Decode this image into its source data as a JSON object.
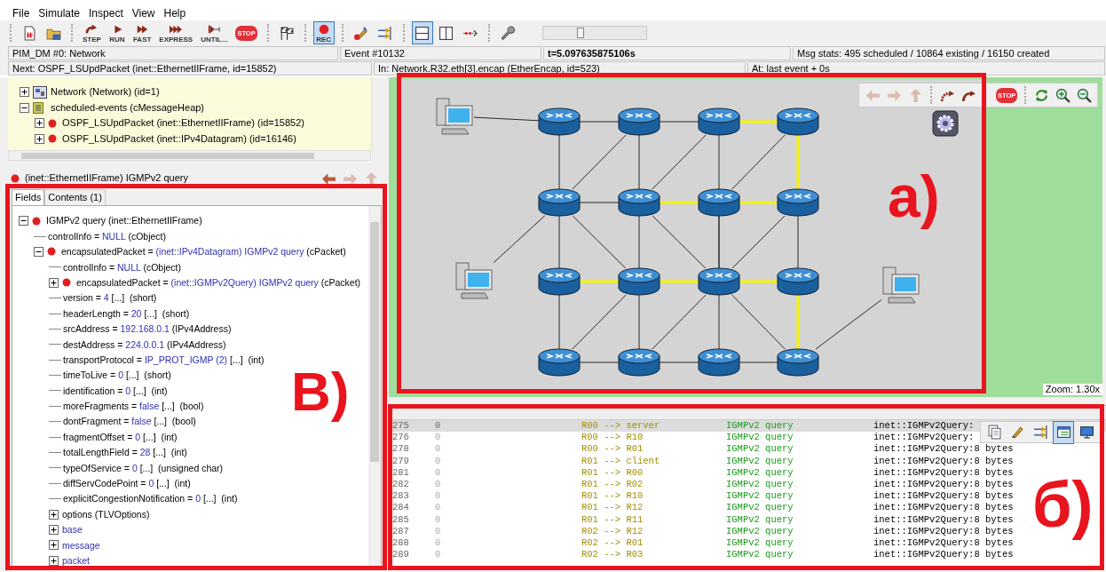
{
  "menu": [
    {
      "label": "File"
    },
    {
      "label": "Simulate"
    },
    {
      "label": "Inspect"
    },
    {
      "label": "View"
    },
    {
      "label": "Help"
    }
  ],
  "toolbar": [
    {
      "kind": "separator"
    },
    {
      "kind": "new"
    },
    {
      "kind": "open"
    },
    {
      "kind": "separator"
    },
    {
      "kind": "step",
      "label": "STEP"
    },
    {
      "kind": "run",
      "label": "RUN"
    },
    {
      "kind": "fast",
      "label": "FAST"
    },
    {
      "kind": "express",
      "label": "EXPRESS"
    },
    {
      "kind": "until",
      "label": "UNTIL..."
    },
    {
      "kind": "stop",
      "label": "STOP"
    },
    {
      "kind": "separator"
    },
    {
      "kind": "finish"
    },
    {
      "kind": "separator"
    },
    {
      "kind": "rec",
      "label": "REC",
      "pressed": true
    },
    {
      "kind": "separator"
    },
    {
      "kind": "inspect"
    },
    {
      "kind": "arrow"
    },
    {
      "kind": "separator"
    },
    {
      "kind": "layout-h",
      "pressed": true
    },
    {
      "kind": "layout-v",
      "pressed": false
    },
    {
      "kind": "timeline"
    },
    {
      "kind": "separator"
    },
    {
      "kind": "wrench"
    }
  ],
  "speed_slider": {
    "level": 0.37
  },
  "status_bar": [
    {
      "text": "PIM_DM #0: Network",
      "bold": false
    },
    {
      "text": "Event #10132",
      "bold": false
    },
    {
      "text": "t=5.097635875106s",
      "bold": true
    },
    {
      "text": "Msg stats: 495 scheduled / 10864 existing / 16150 created",
      "bold": false
    }
  ],
  "next_bar": [
    {
      "text": "Next: OSPF_LSUpdPacket (inet::EthernetIIFrame, id=15852)"
    },
    {
      "text": "In: Network.R32.eth[3].encap (EtherEncap, id=523)"
    },
    {
      "text": "At: last event + 0s"
    }
  ],
  "object_tree": [
    {
      "kind": "network",
      "label": "Network (Network) (id=1)",
      "expanded": false
    },
    {
      "kind": "queue",
      "label": "scheduled-events (cMessageHeap)",
      "expanded": true,
      "children": [
        {
          "kind": "message",
          "label": "OSPF_LSUpdPacket (inet::EthernetIIFrame) (id=15852)",
          "expanded": false
        },
        {
          "kind": "message",
          "label": "OSPF_LSUpdPacket (inet::IPv4Datagram) (id=16146)",
          "expanded": false
        }
      ]
    }
  ],
  "inspector": {
    "title": "(inet::EthernetIIFrame) IGMPv2 query",
    "nav": [
      {
        "kind": "back",
        "disabled": false
      },
      {
        "kind": "forward",
        "disabled": true
      },
      {
        "kind": "up",
        "disabled": true
      }
    ],
    "tabs": [
      {
        "label": "Fields",
        "selected": true
      },
      {
        "label": "Contents (1)",
        "selected": false
      }
    ],
    "fields": [
      {
        "kind": "message",
        "label": "IGMPv2 query (inet::EthernetIIFrame)",
        "expanded": true,
        "children": [
          {
            "kind": "field",
            "label": "controlInfo = ",
            "value": "NULL",
            "rest": " (cObject)"
          },
          {
            "kind": "message",
            "label": "encapsulatedPacket = ",
            "value": "(inet::IPv4Datagram) IGMPv2 query",
            "rest": " (cPacket)",
            "expanded": true,
            "children": [
              {
                "kind": "field",
                "label": "controlInfo = ",
                "value": "NULL",
                "rest": " (cObject)"
              },
              {
                "kind": "message",
                "label": "encapsulatedPacket = ",
                "value": "(inet::IGMPv2Query) IGMPv2 query",
                "rest": " (cPacket)",
                "expanded": false
              },
              {
                "kind": "field",
                "label": "version = ",
                "value": "4",
                "rest": " [...]  (short)"
              },
              {
                "kind": "field",
                "label": "headerLength = ",
                "value": "20",
                "rest": " [...]  (short)"
              },
              {
                "kind": "field",
                "label": "srcAddress = ",
                "value": "192.168.0.1",
                "rest": " (IPv4Address)"
              },
              {
                "kind": "field",
                "label": "destAddress = ",
                "value": "224.0.0.1",
                "rest": " (IPv4Address)"
              },
              {
                "kind": "field",
                "label": "transportProtocol = ",
                "value": "IP_PROT_IGMP (2)",
                "rest": " [...]  (int)"
              },
              {
                "kind": "field",
                "label": "timeToLive = ",
                "value": "0",
                "rest": " [...]  (short)"
              },
              {
                "kind": "field",
                "label": "identification = ",
                "value": "0",
                "rest": " [...]  (int)"
              },
              {
                "kind": "field",
                "label": "moreFragments = ",
                "value": "false",
                "rest": " [...]  (bool)"
              },
              {
                "kind": "field",
                "label": "dontFragment = ",
                "value": "false",
                "rest": " [...]  (bool)"
              },
              {
                "kind": "field",
                "label": "fragmentOffset = ",
                "value": "0",
                "rest": " [...]  (int)"
              },
              {
                "kind": "field",
                "label": "totalLengthField = ",
                "value": "28",
                "rest": " [...]  (int)"
              },
              {
                "kind": "field",
                "label": "typeOfService = ",
                "value": "0",
                "rest": " [...]  (unsigned char)"
              },
              {
                "kind": "field",
                "label": "diffServCodePoint = ",
                "value": "0",
                "rest": " [...]  (int)"
              },
              {
                "kind": "field",
                "label": "explicitCongestionNotification = ",
                "value": "0",
                "rest": " [...]  (int)"
              },
              {
                "kind": "field",
                "label": "options (TLVOptions)",
                "expanded": false
              },
              {
                "kind": "field",
                "value": "base",
                "expanded": false
              },
              {
                "kind": "field",
                "value": "message",
                "expanded": false
              },
              {
                "kind": "field",
                "value": "packet",
                "expanded": false
              }
            ]
          }
        ]
      }
    ],
    "annotation": "B)"
  },
  "network": {
    "toolbar": [
      {
        "kind": "back",
        "disabled": true
      },
      {
        "kind": "forward",
        "disabled": true
      },
      {
        "kind": "up",
        "disabled": true
      },
      {
        "kind": "separator"
      },
      {
        "kind": "curve-left"
      },
      {
        "kind": "curve-right"
      },
      {
        "kind": "stop",
        "label": "STOP"
      },
      {
        "kind": "separator"
      },
      {
        "kind": "refresh"
      },
      {
        "kind": "zoom-in"
      },
      {
        "kind": "zoom-out"
      }
    ],
    "zoom": "Zoom: 1.30x",
    "annotation": "a)"
  },
  "log": {
    "toolbar": [
      {
        "kind": "copy"
      },
      {
        "kind": "find"
      },
      {
        "kind": "filter"
      },
      {
        "kind": "layout",
        "pressed": true
      },
      {
        "kind": "screen"
      }
    ],
    "rows": [
      {
        "event": "275",
        "time": "0",
        "route": "R00 --> server",
        "name": "IGMPv2 query",
        "info": "inet::IGMPv2Query:",
        "selected": true
      },
      {
        "event": "276",
        "time": "0",
        "route": "R00 --> R10",
        "name": "IGMPv2 query",
        "info": "inet::IGMPv2Query:",
        "selected": false
      },
      {
        "event": "278",
        "time": "0",
        "route": "R00 --> R01",
        "name": "IGMPv2 query",
        "info": "inet::IGMPv2Query:8 bytes",
        "selected": false
      },
      {
        "event": "279",
        "time": "0",
        "route": "R01 --> client",
        "name": "IGMPv2 query",
        "info": "inet::IGMPv2Query:8 bytes",
        "selected": false
      },
      {
        "event": "281",
        "time": "0",
        "route": "R01 --> R00",
        "name": "IGMPv2 query",
        "info": "inet::IGMPv2Query:8 bytes",
        "selected": false
      },
      {
        "event": "282",
        "time": "0",
        "route": "R01 --> R02",
        "name": "IGMPv2 query",
        "info": "inet::IGMPv2Query:8 bytes",
        "selected": false
      },
      {
        "event": "283",
        "time": "0",
        "route": "R01 --> R10",
        "name": "IGMPv2 query",
        "info": "inet::IGMPv2Query:8 bytes",
        "selected": false
      },
      {
        "event": "284",
        "time": "0",
        "route": "R01 --> R12",
        "name": "IGMPv2 query",
        "info": "inet::IGMPv2Query:8 bytes",
        "selected": false
      },
      {
        "event": "285",
        "time": "0",
        "route": "R01 --> R11",
        "name": "IGMPv2 query",
        "info": "inet::IGMPv2Query:8 bytes",
        "selected": false
      },
      {
        "event": "287",
        "time": "0",
        "route": "R02 --> R12",
        "name": "IGMPv2 query",
        "info": "inet::IGMPv2Query:8 bytes",
        "selected": false
      },
      {
        "event": "288",
        "time": "0",
        "route": "R02 --> R01",
        "name": "IGMPv2 query",
        "info": "inet::IGMPv2Query:8 bytes",
        "selected": false
      },
      {
        "event": "289",
        "time": "0",
        "route": "R02 --> R03",
        "name": "IGMPv2 query",
        "info": "inet::IGMPv2Query:8 bytes",
        "selected": false
      }
    ],
    "annotation": "б)"
  }
}
